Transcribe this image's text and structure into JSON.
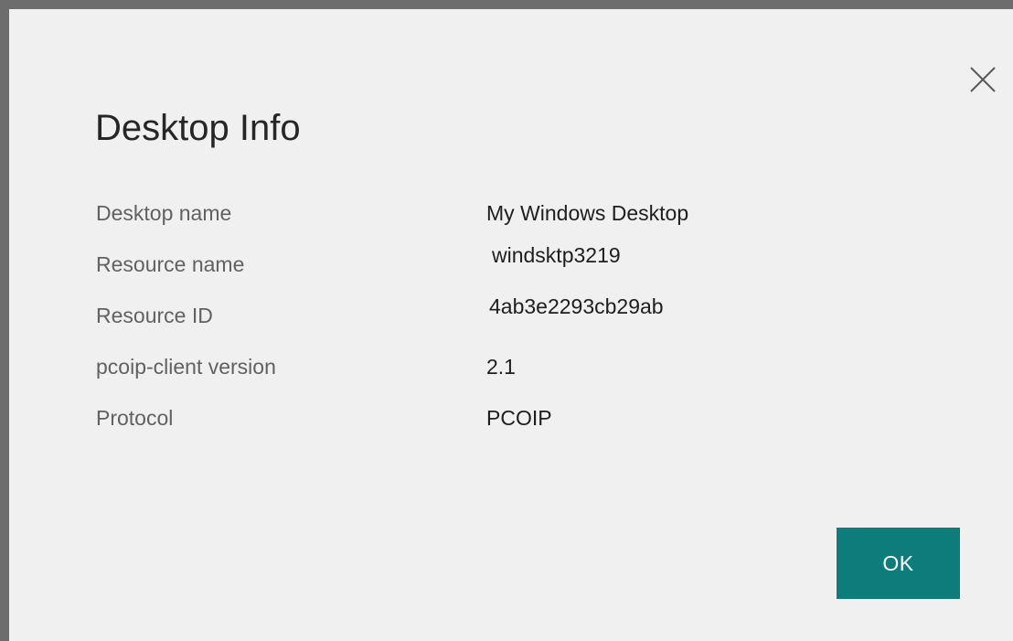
{
  "dialog": {
    "title": "Desktop Info",
    "close_icon": "close-icon",
    "ok_label": "OK",
    "accent_color": "#0e7c7b"
  },
  "info": {
    "rows": [
      {
        "label": "Desktop name",
        "value": "My Windows Desktop"
      },
      {
        "label": "Resource name",
        "value": "windsktp3219"
      },
      {
        "label": "Resource ID",
        "value": "4ab3e2293cb29ab"
      },
      {
        "label": "pcoip-client version",
        "value": "2.1"
      },
      {
        "label": "Protocol",
        "value": "PCOIP"
      }
    ]
  }
}
